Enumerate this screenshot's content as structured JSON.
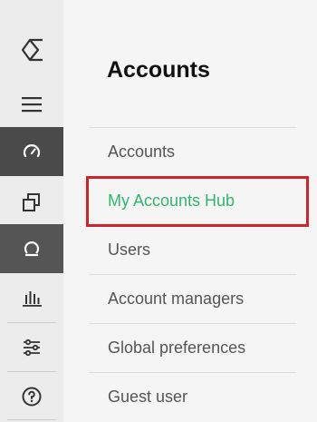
{
  "sidebar": {
    "icons": [
      {
        "name": "logo-icon"
      },
      {
        "name": "hamburger-menu-icon"
      },
      {
        "name": "speedometer-icon"
      },
      {
        "name": "copy-squares-icon"
      },
      {
        "name": "omega-icon"
      },
      {
        "name": "bar-chart-icon"
      },
      {
        "name": "sliders-icon"
      },
      {
        "name": "help-circle-icon"
      }
    ],
    "colors": {
      "background": "#ececec",
      "active_background": "#4a4a4a"
    }
  },
  "panel": {
    "title": "Accounts",
    "items": [
      {
        "label": "Accounts"
      },
      {
        "label": "My Accounts Hub",
        "active": true
      },
      {
        "label": "Users"
      },
      {
        "label": "Account managers"
      },
      {
        "label": "Global preferences"
      },
      {
        "label": "Guest user"
      }
    ]
  },
  "colors": {
    "active_text": "#2fb76b",
    "highlight_border": "#d2232a"
  }
}
